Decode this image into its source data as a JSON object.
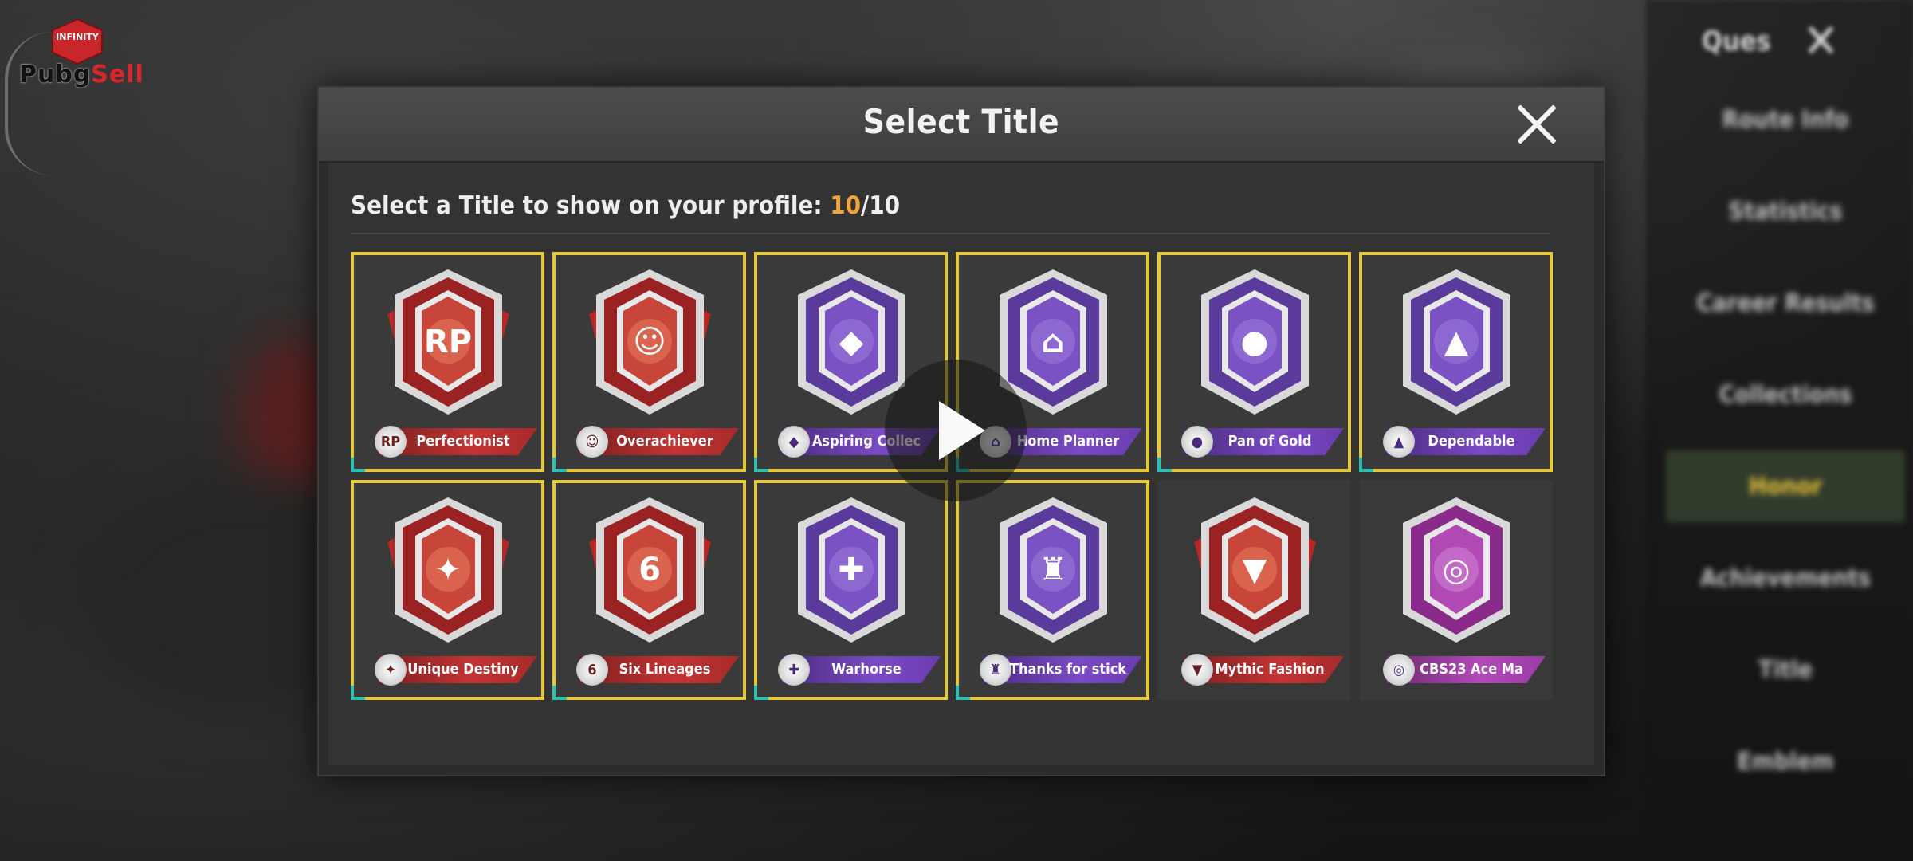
{
  "watermark": {
    "hex_text": "INFINITY",
    "word_dark": "Pubg",
    "word_red": "Sell"
  },
  "background": {
    "right_tabs": [
      "Ques"
    ],
    "right_menu": [
      "Route Info",
      "Statistics",
      "Career Results",
      "Collections",
      "Honor",
      "Achievements",
      "Title",
      "Emblem"
    ],
    "active_menu_index": 4
  },
  "modal": {
    "title": "Select Title",
    "subtitle_prefix": "Select a Title to show on your profile: ",
    "count_selected": "10",
    "count_total": "/10"
  },
  "titles": [
    {
      "label": "Perfectionist",
      "color": "red",
      "glyph": "RP",
      "selected": true
    },
    {
      "label": "Overachiever",
      "color": "red",
      "glyph": "☺",
      "selected": true
    },
    {
      "label": "Aspiring Collec",
      "color": "purple",
      "glyph": "◆",
      "selected": true
    },
    {
      "label": "Home Planner",
      "color": "purple",
      "glyph": "⌂",
      "selected": true
    },
    {
      "label": "Pan of Gold",
      "color": "purple",
      "glyph": "●",
      "selected": true
    },
    {
      "label": "Dependable",
      "color": "purple",
      "glyph": "▲",
      "selected": true
    },
    {
      "label": "Unique Destiny",
      "color": "red",
      "glyph": "✦",
      "selected": true
    },
    {
      "label": "Six Lineages",
      "color": "red",
      "glyph": "6",
      "selected": true
    },
    {
      "label": "Warhorse",
      "color": "purple",
      "glyph": "✚",
      "selected": true
    },
    {
      "label": "Thanks for stick",
      "color": "purple",
      "glyph": "♜",
      "selected": true
    },
    {
      "label": "Mythic Fashion",
      "color": "red",
      "glyph": "▼",
      "selected": false
    },
    {
      "label": "CBS23 Ace Ma",
      "color": "pink",
      "glyph": "◎",
      "selected": false
    }
  ],
  "colors": {
    "selected_border": "#e3c83a",
    "count_accent": "#f0a53a",
    "red_badge": "#b0302e",
    "purple_badge": "#6a40b0",
    "pink_badge": "#a83aa8"
  },
  "overlay": {
    "play_icon": "play-icon"
  }
}
